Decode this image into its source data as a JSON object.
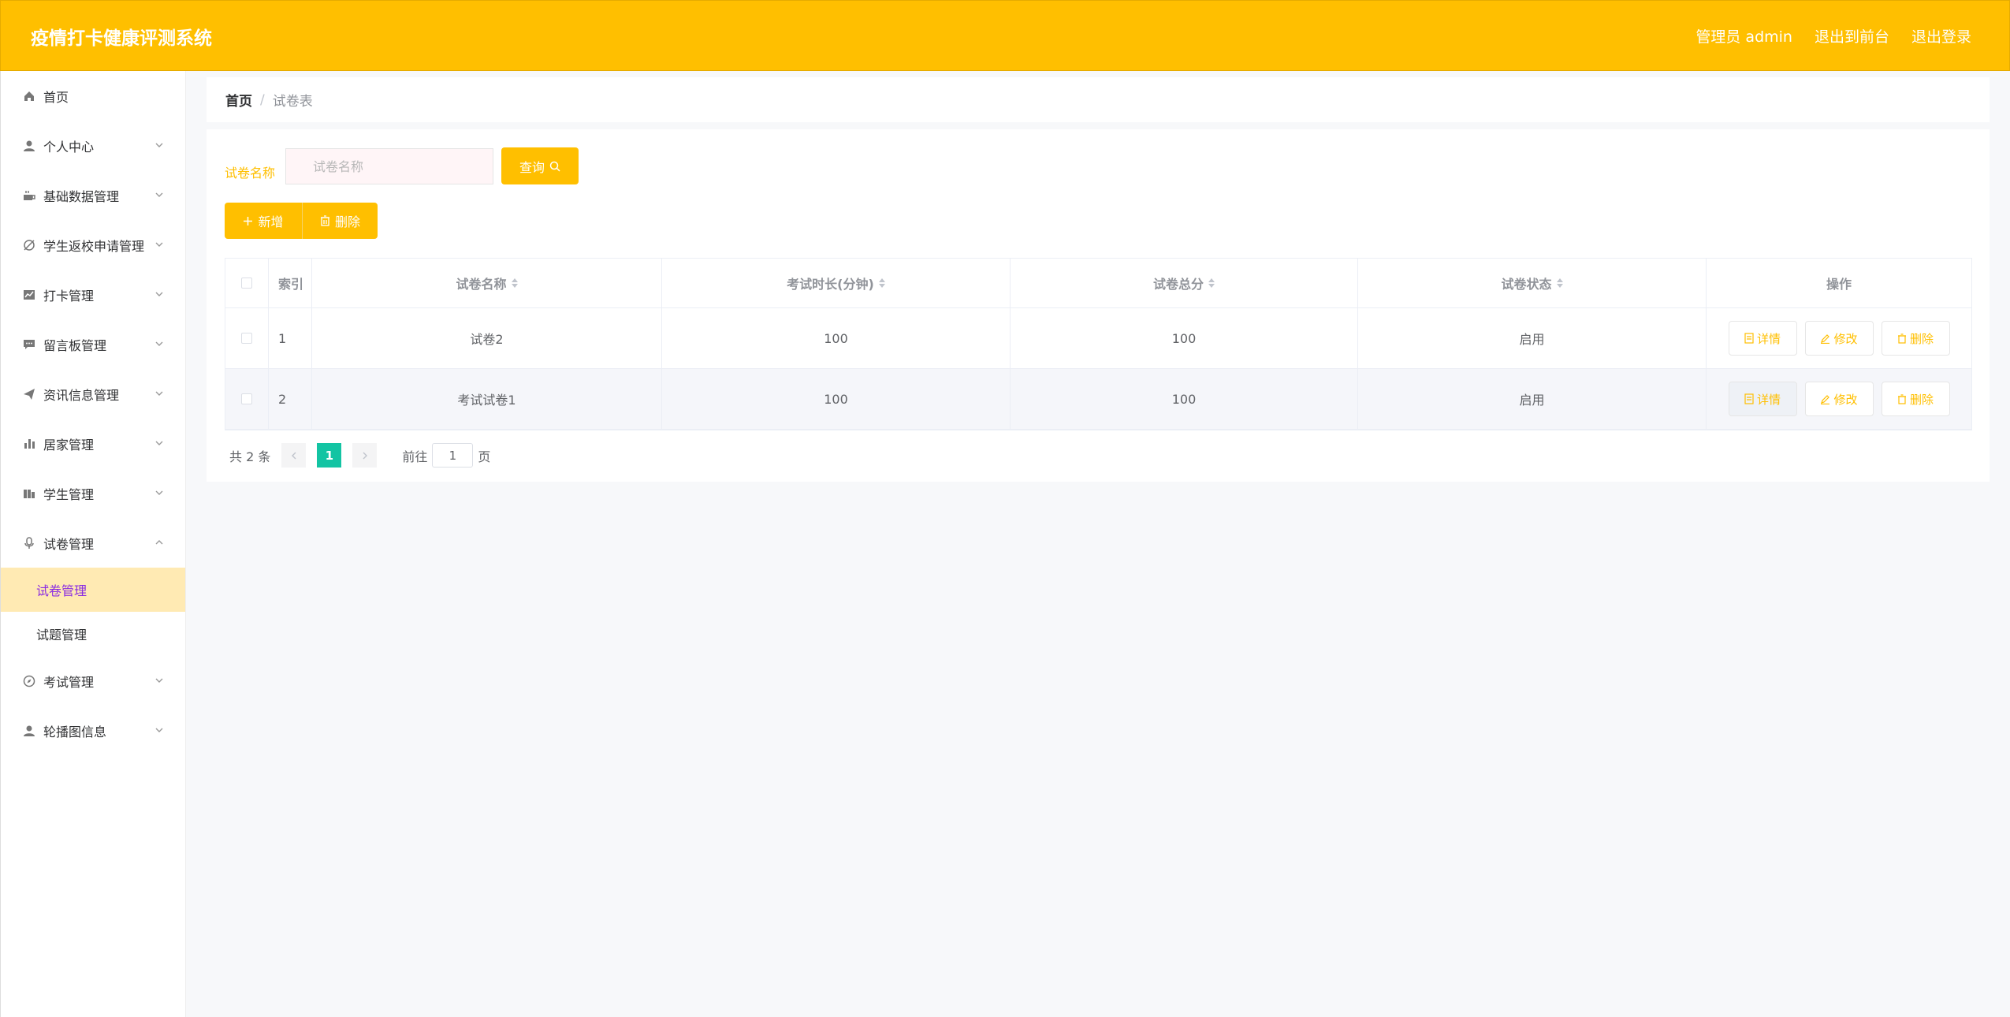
{
  "header": {
    "title": "疫情打卡健康评测系统",
    "user_label": "管理员 admin",
    "front_link": "退出到前台",
    "logout_link": "退出登录"
  },
  "sidebar": {
    "items": [
      {
        "label": "首页",
        "icon": "home-icon"
      },
      {
        "label": "个人中心",
        "icon": "user-icon"
      },
      {
        "label": "基础数据管理",
        "icon": "coffee-icon"
      },
      {
        "label": "学生返校申请管理",
        "icon": "stamp-icon"
      },
      {
        "label": "打卡管理",
        "icon": "chart-icon"
      },
      {
        "label": "留言板管理",
        "icon": "message-icon"
      },
      {
        "label": "资讯信息管理",
        "icon": "send-icon"
      },
      {
        "label": "居家管理",
        "icon": "bar-chart-icon"
      },
      {
        "label": "学生管理",
        "icon": "data-icon"
      },
      {
        "label": "试卷管理",
        "icon": "mic-icon"
      },
      {
        "label": "考试管理",
        "icon": "compass-icon"
      },
      {
        "label": "轮播图信息",
        "icon": "user-icon"
      }
    ],
    "sub_items": [
      "试卷管理",
      "试题管理"
    ]
  },
  "breadcrumb": {
    "home": "首页",
    "separator": "/",
    "current": "试卷表"
  },
  "search": {
    "label": "试卷名称",
    "placeholder": "试卷名称",
    "query_button": "查询"
  },
  "actions": {
    "add": "新增",
    "delete": "删除"
  },
  "table": {
    "headers": {
      "index": "索引",
      "name": "试卷名称",
      "duration": "考试时长(分钟)",
      "score": "试卷总分",
      "status": "试卷状态",
      "ops": "操作"
    },
    "rows": [
      {
        "index": "1",
        "name": "试卷2",
        "duration": "100",
        "score": "100",
        "status": "启用"
      },
      {
        "index": "2",
        "name": "考试试卷1",
        "duration": "100",
        "score": "100",
        "status": "启用"
      }
    ],
    "op_labels": {
      "detail": "详情",
      "edit": "修改",
      "delete": "删除"
    }
  },
  "pager": {
    "total": "共 2 条",
    "current_page": "1",
    "goto_prefix": "前往",
    "goto_value": "1",
    "goto_suffix": "页"
  },
  "colors": {
    "accent": "#ffbf00",
    "active_bg": "#ffeab3",
    "page_active": "#13c4a3"
  }
}
